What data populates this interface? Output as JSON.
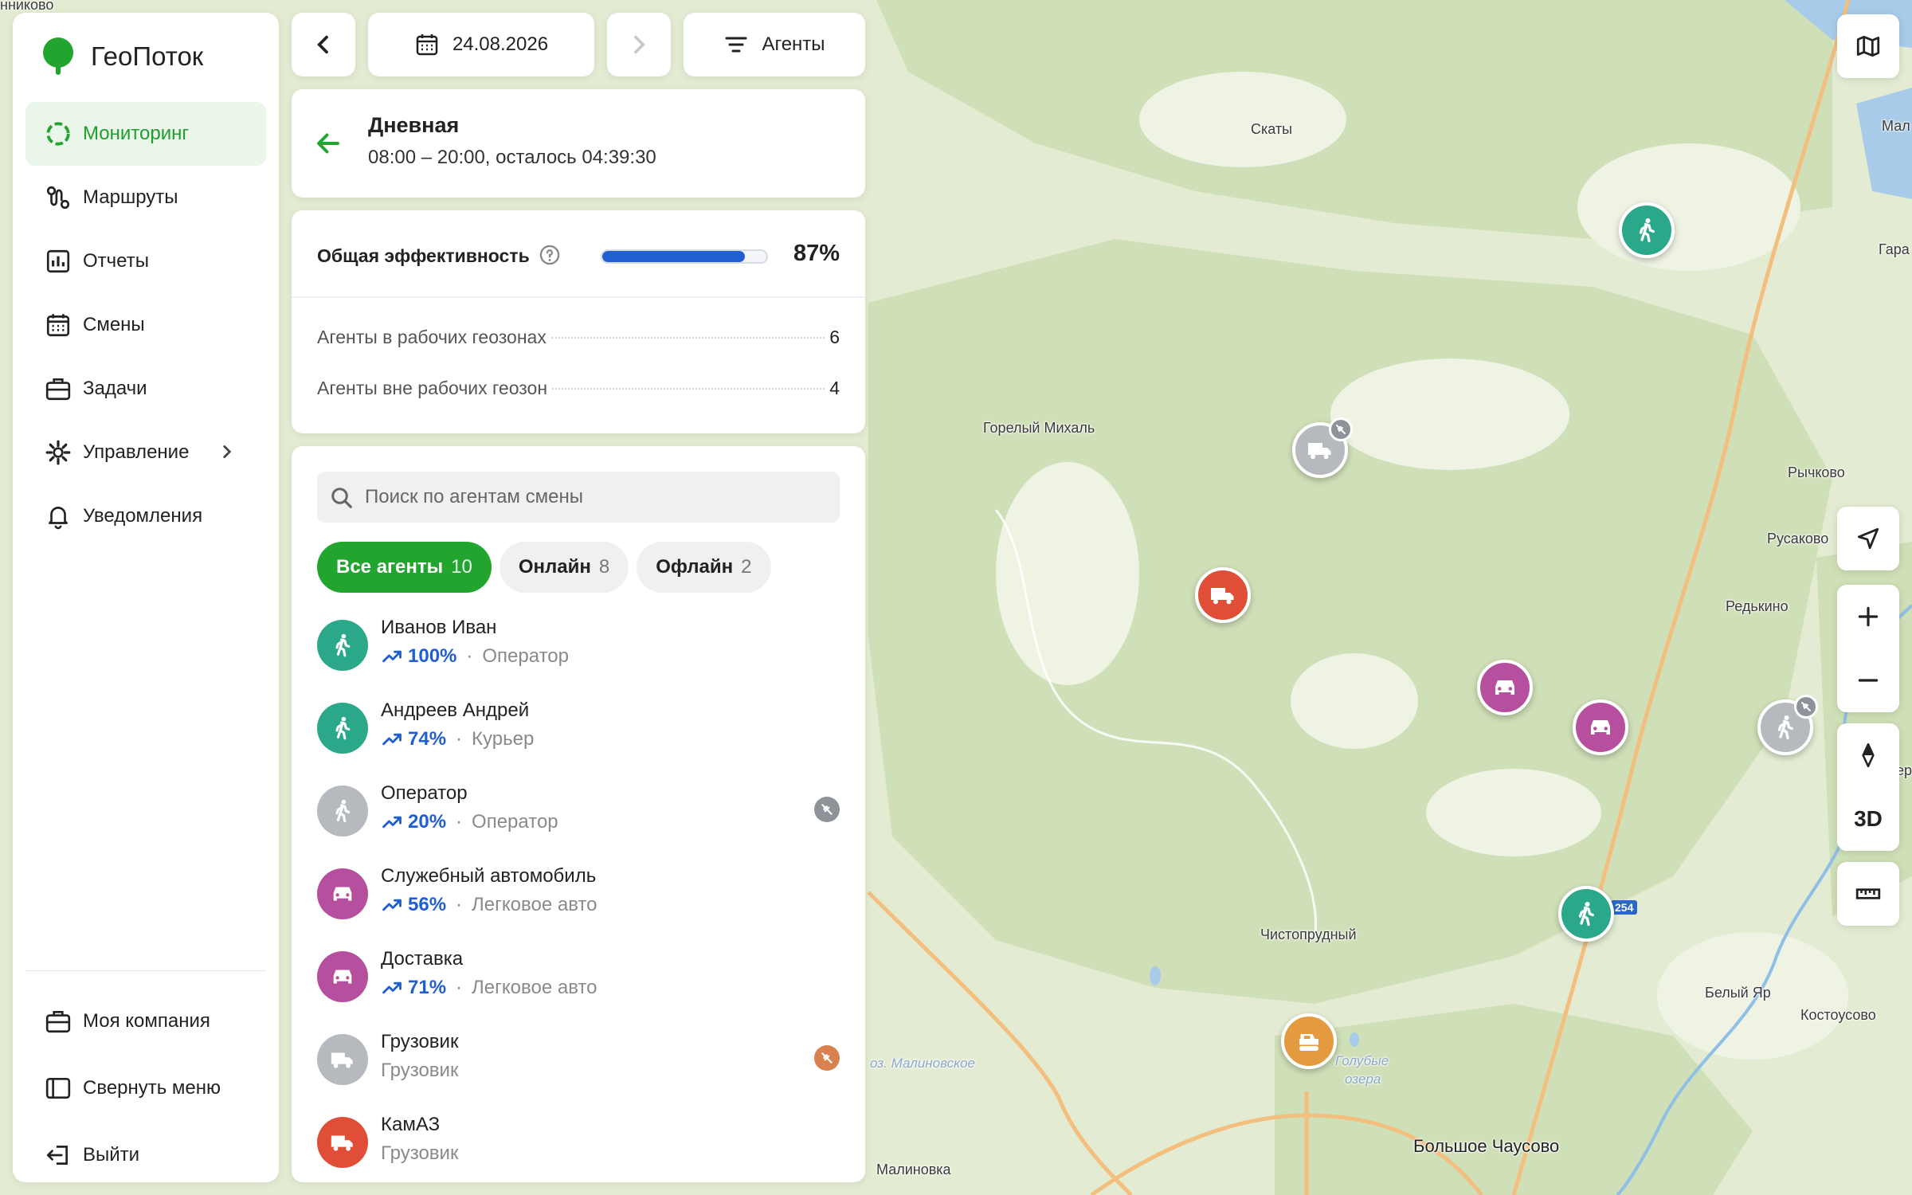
{
  "brand": {
    "name": "ГеоПоток"
  },
  "nav": {
    "items": [
      {
        "label": "Мониторинг",
        "icon": "monitoring-icon"
      },
      {
        "label": "Маршруты",
        "icon": "routes-icon"
      },
      {
        "label": "Отчеты",
        "icon": "reports-icon"
      },
      {
        "label": "Смены",
        "icon": "calendar-icon"
      },
      {
        "label": "Задачи",
        "icon": "briefcase-icon"
      },
      {
        "label": "Управление",
        "icon": "gear-icon"
      },
      {
        "label": "Уведомления",
        "icon": "bell-icon"
      }
    ],
    "bottom": [
      {
        "label": "Моя компания",
        "icon": "company-icon"
      },
      {
        "label": "Свернуть меню",
        "icon": "collapse-icon"
      },
      {
        "label": "Выйти",
        "icon": "logout-icon"
      }
    ]
  },
  "toolbar": {
    "date": "24.08.2026",
    "filter_label": "Агенты"
  },
  "shift": {
    "title": "Дневная",
    "time": "08:00 – 20:00, осталось 04:39:30"
  },
  "efficiency": {
    "label": "Общая эффективность",
    "value_text": "87%",
    "value": 0.87,
    "stats": [
      {
        "label": "Агенты в рабочих геозонах",
        "value": "6"
      },
      {
        "label": "Агенты вне рабочих геозон",
        "value": "4"
      }
    ]
  },
  "agents_panel": {
    "search_placeholder": "Поиск по агентам смены",
    "filters": [
      {
        "label": "Все агенты",
        "count": "10",
        "active": true
      },
      {
        "label": "Онлайн",
        "count": "8",
        "active": false
      },
      {
        "label": "Офлайн",
        "count": "2",
        "active": false
      }
    ],
    "agents": [
      {
        "name": "Иванов Иван",
        "pct": "100%",
        "role": "Оператор",
        "type": "walker",
        "color": "#2aa889",
        "status": null
      },
      {
        "name": "Андреев Андрей",
        "pct": "74%",
        "role": "Курьер",
        "type": "walker",
        "color": "#2aa889",
        "status": null
      },
      {
        "name": "Оператор",
        "pct": "20%",
        "role": "Оператор",
        "type": "walker",
        "color": "#b6b9be",
        "status": "offline"
      },
      {
        "name": "Служебный автомобиль",
        "pct": "56%",
        "role": "Легковое авто",
        "type": "car",
        "color": "#b64f9e",
        "status": null
      },
      {
        "name": "Доставка",
        "pct": "71%",
        "role": "Легковое авто",
        "type": "car",
        "color": "#b64f9e",
        "status": null
      },
      {
        "name": "Грузовик",
        "pct": "",
        "role": "Грузовик",
        "type": "truck",
        "color": "#b6b9be",
        "status": "alert"
      },
      {
        "name": "КамАЗ",
        "pct": "",
        "role": "Грузовик",
        "type": "truck",
        "color": "#e04e37",
        "status": null
      }
    ]
  },
  "map": {
    "labels": [
      {
        "text": "Скаты"
      },
      {
        "text": "Горелый Михаль"
      },
      {
        "text": "Рычково"
      },
      {
        "text": "Русаково"
      },
      {
        "text": "Редькино"
      },
      {
        "text": "Чистопрудный"
      },
      {
        "text": "Белый Яр"
      },
      {
        "text": "Костоусово"
      },
      {
        "text": "Большое Чаусово"
      },
      {
        "text": "Малиновка"
      },
      {
        "text": "оз. Малиновское"
      },
      {
        "text": "Голубые"
      },
      {
        "text": "озера"
      },
      {
        "text": "нниково"
      },
      {
        "text": "Мал"
      },
      {
        "text": "Гара"
      },
      {
        "text": "ер"
      }
    ],
    "road_number": "254",
    "markers": [
      {
        "type": "walker",
        "color": "#2aa889",
        "status": null
      },
      {
        "type": "truck",
        "color": "#b6b9be",
        "status": "offline"
      },
      {
        "type": "truck",
        "color": "#e04e37",
        "status": null
      },
      {
        "type": "car",
        "color": "#b64f9e",
        "status": null
      },
      {
        "type": "car",
        "color": "#b64f9e",
        "status": null
      },
      {
        "type": "walker",
        "color": "#b6b9be",
        "status": "offline"
      },
      {
        "type": "walker",
        "color": "#2aa889",
        "status": null
      },
      {
        "type": "tractor",
        "color": "#e49a3e",
        "status": null
      }
    ]
  },
  "map_controls": {
    "mode_3d": "3D"
  },
  "colors": {
    "accent": "#22a52f",
    "efficiency_bar": "#1f5fd1"
  }
}
